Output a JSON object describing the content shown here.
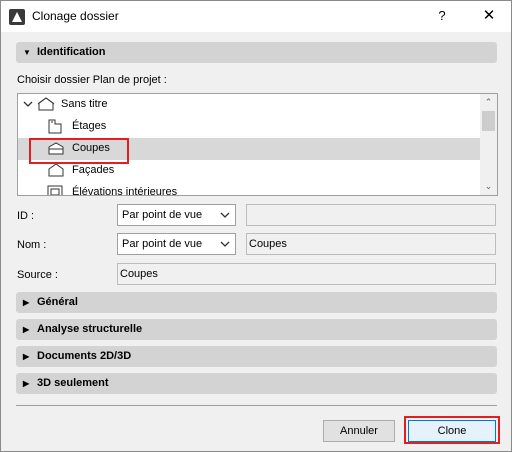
{
  "window": {
    "title": "Clonage dossier",
    "help_label": "?",
    "close_label": "✕"
  },
  "identification": {
    "header": "Identification",
    "choose_label": "Choisir dossier Plan de projet :",
    "tree": [
      {
        "label": "Sans titre",
        "icon": "house-icon",
        "expanded": true
      },
      {
        "label": "Étages",
        "icon": "storey-icon"
      },
      {
        "label": "Coupes",
        "icon": "section-icon",
        "selected": true
      },
      {
        "label": "Façades",
        "icon": "elevation-icon"
      },
      {
        "label": "Élévations intérieures",
        "icon": "interior-elevation-icon"
      }
    ],
    "id_label": "ID :",
    "id_mode": "Par point de vue",
    "id_value": "",
    "name_label": "Nom :",
    "name_mode": "Par point de vue",
    "name_value": "Coupes",
    "source_label": "Source :",
    "source_value": "Coupes"
  },
  "sections": [
    {
      "label": "Général"
    },
    {
      "label": "Analyse structurelle"
    },
    {
      "label": "Documents 2D/3D"
    },
    {
      "label": "3D seulement"
    }
  ],
  "footer": {
    "cancel_label": "Annuler",
    "clone_label": "Clone"
  },
  "colors": {
    "highlight": "#e02020",
    "primary_border": "#0078d7",
    "selected_row": "#d8d8d8"
  }
}
